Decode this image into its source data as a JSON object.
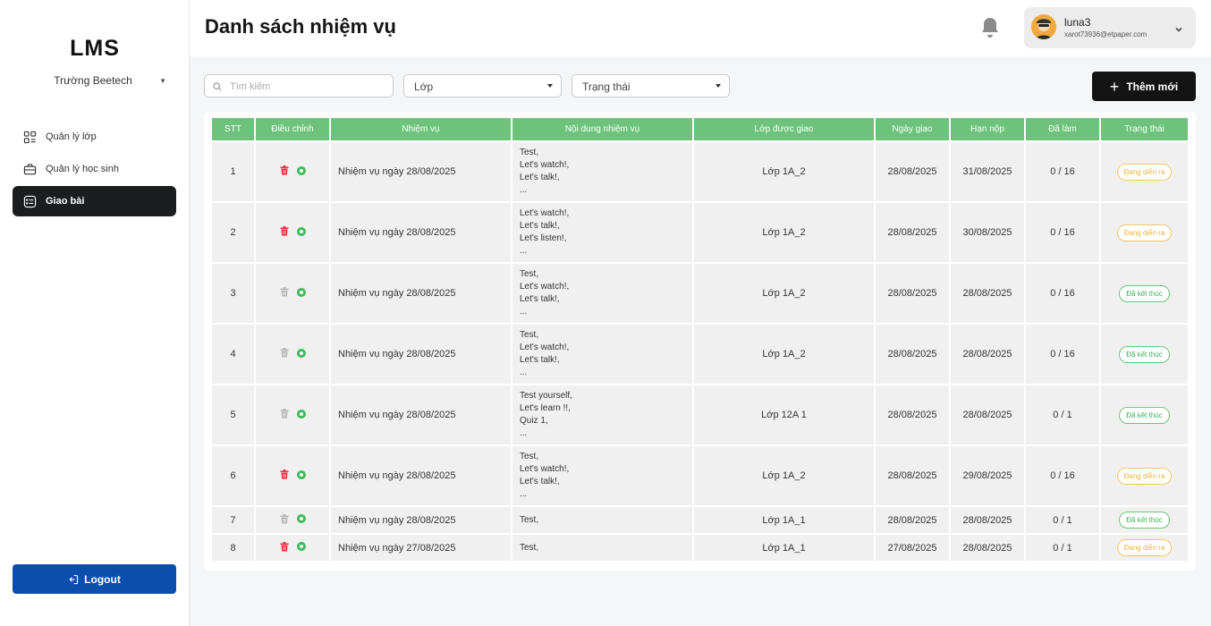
{
  "sidebar": {
    "logo": "LMS",
    "school": "Trường Beetech",
    "nav": [
      {
        "label": "Quản lý lớp",
        "icon": "grid-icon",
        "active": false
      },
      {
        "label": "Quản lý học sinh",
        "icon": "briefcase-icon",
        "active": false
      },
      {
        "label": "Giao bài",
        "icon": "list-check-icon",
        "active": true
      }
    ],
    "logout": "Logout"
  },
  "header": {
    "title": "Danh sách nhiệm vụ",
    "user_name": "luna3",
    "user_email": "xarot73936@etpaper.com"
  },
  "filters": {
    "search_placeholder": "Tìm kiếm",
    "class_select": "Lớp",
    "status_select": "Trạng thái",
    "add_button": "Thêm mới"
  },
  "table": {
    "headers": [
      "STT",
      "Điều chỉnh",
      "Nhiệm vụ",
      "Nội dung nhiệm vụ",
      "Lớp được giao",
      "Ngày giao",
      "Hạn nộp",
      "Đã làm",
      "Trạng thái"
    ],
    "rows": [
      {
        "stt": "1",
        "deletable": true,
        "task": "Nhiệm vụ ngày 28/08/2025",
        "content": [
          "Test,",
          "Let's watch!,",
          "Let's talk!,",
          "..."
        ],
        "class": "Lớp 1A_2",
        "date": "28/08/2025",
        "deadline": "31/08/2025",
        "done": "0 / 16",
        "status": "Đang diễn ra",
        "status_type": "ongoing"
      },
      {
        "stt": "2",
        "deletable": true,
        "task": "Nhiệm vụ ngày 28/08/2025",
        "content": [
          "Let's watch!,",
          "Let's talk!,",
          "Let's listen!,",
          "..."
        ],
        "class": "Lớp 1A_2",
        "date": "28/08/2025",
        "deadline": "30/08/2025",
        "done": "0 / 16",
        "status": "Đang diễn ra",
        "status_type": "ongoing"
      },
      {
        "stt": "3",
        "deletable": false,
        "task": "Nhiệm vụ ngày 28/08/2025",
        "content": [
          "Test,",
          "Let's watch!,",
          "Let's talk!,",
          "..."
        ],
        "class": "Lớp 1A_2",
        "date": "28/08/2025",
        "deadline": "28/08/2025",
        "done": "0 / 16",
        "status": "Đã kết thúc",
        "status_type": "done"
      },
      {
        "stt": "4",
        "deletable": false,
        "task": "Nhiệm vụ ngày 28/08/2025",
        "content": [
          "Test,",
          "Let's watch!,",
          "Let's talk!,",
          "..."
        ],
        "class": "Lớp 1A_2",
        "date": "28/08/2025",
        "deadline": "28/08/2025",
        "done": "0 / 16",
        "status": "Đã kết thúc",
        "status_type": "done"
      },
      {
        "stt": "5",
        "deletable": false,
        "task": "Nhiệm vụ ngày 28/08/2025",
        "content": [
          "Test yourself,",
          "Let's learn !!,",
          "Quiz 1,",
          "..."
        ],
        "class": "Lớp 12A 1",
        "date": "28/08/2025",
        "deadline": "28/08/2025",
        "done": "0 / 1",
        "status": "Đã kết thúc",
        "status_type": "done"
      },
      {
        "stt": "6",
        "deletable": true,
        "task": "Nhiệm vụ ngày 28/08/2025",
        "content": [
          "Test,",
          "Let's watch!,",
          "Let's talk!,",
          "..."
        ],
        "class": "Lớp 1A_2",
        "date": "28/08/2025",
        "deadline": "29/08/2025",
        "done": "0 / 16",
        "status": "Đang diễn ra",
        "status_type": "ongoing"
      },
      {
        "stt": "7",
        "deletable": false,
        "task": "Nhiệm vụ ngày 28/08/2025",
        "content": [
          "Test,"
        ],
        "class": "Lớp 1A_1",
        "date": "28/08/2025",
        "deadline": "28/08/2025",
        "done": "0 / 1",
        "status": "Đã kết thúc",
        "status_type": "done"
      },
      {
        "stt": "8",
        "deletable": true,
        "task": "Nhiệm vụ ngày 27/08/2025",
        "content": [
          "Test,"
        ],
        "class": "Lớp 1A_1",
        "date": "27/08/2025",
        "deadline": "28/08/2025",
        "done": "0 / 1",
        "status": "Đang diễn ra",
        "status_type": "ongoing"
      }
    ]
  },
  "colors": {
    "header_green": "#6dc37b",
    "delete_red": "#e8323c",
    "delete_disabled": "#b8b8b8",
    "view_green": "#3dbb5a",
    "ongoing": "#f0b43a",
    "done": "#3cb259",
    "logout_blue": "#0b4fae"
  }
}
